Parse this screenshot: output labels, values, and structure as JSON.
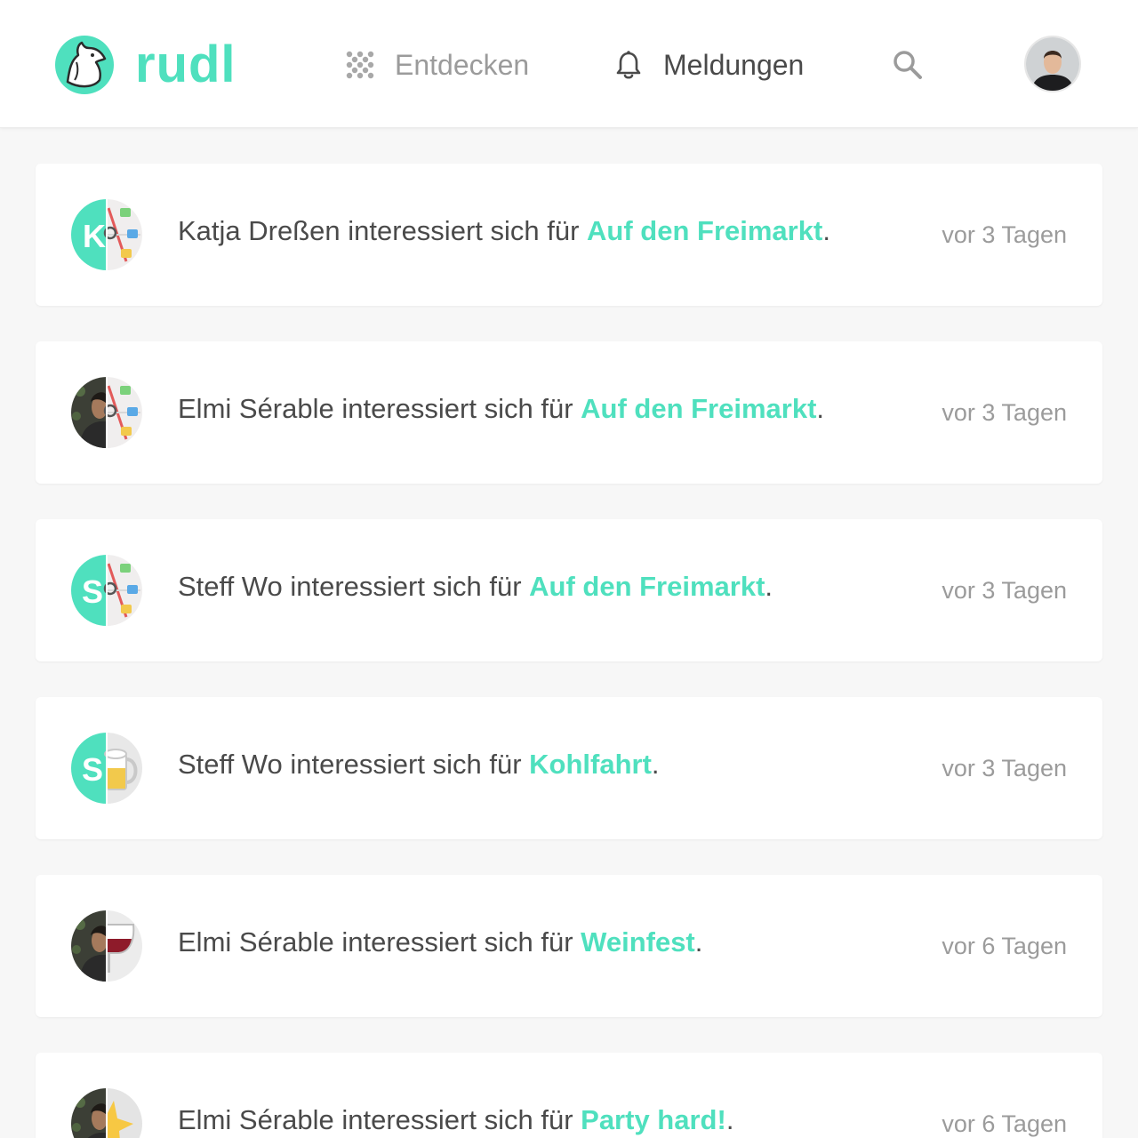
{
  "header": {
    "logo_text": "rudl",
    "nav": {
      "discover_label": "Entdecken",
      "notifications_label": "Meldungen"
    }
  },
  "colors": {
    "accent": "#4fe0be",
    "text": "#4a4a4a",
    "muted": "#9b9b9b",
    "background": "#f7f7f7"
  },
  "notifications": [
    {
      "user": "Katja Dreßen",
      "action": "interessiert sich für",
      "event": "Auf den Freimarkt",
      "time": "vor 3 Tagen",
      "avatar_left": "initial-K",
      "avatar_right": "freimarkt-map"
    },
    {
      "user": "Elmi Sérable",
      "action": "interessiert sich für",
      "event": "Auf den Freimarkt",
      "time": "vor 3 Tagen",
      "avatar_left": "photo",
      "avatar_right": "freimarkt-map"
    },
    {
      "user": "Steff Wo",
      "action": "interessiert sich für",
      "event": "Auf den Freimarkt",
      "time": "vor 3 Tagen",
      "avatar_left": "initial-S",
      "avatar_right": "freimarkt-map"
    },
    {
      "user": "Steff Wo",
      "action": "interessiert sich für",
      "event": "Kohlfahrt",
      "time": "vor 3 Tagen",
      "avatar_left": "initial-S",
      "avatar_right": "beer-mug"
    },
    {
      "user": "Elmi Sérable",
      "action": "interessiert sich für",
      "event": "Weinfest",
      "time": "vor 6 Tagen",
      "avatar_left": "photo",
      "avatar_right": "wine-glass"
    },
    {
      "user": "Elmi Sérable",
      "action": "interessiert sich für",
      "event": "Party hard!",
      "time": "vor 6 Tagen",
      "avatar_left": "photo",
      "avatar_right": "party-star"
    }
  ]
}
